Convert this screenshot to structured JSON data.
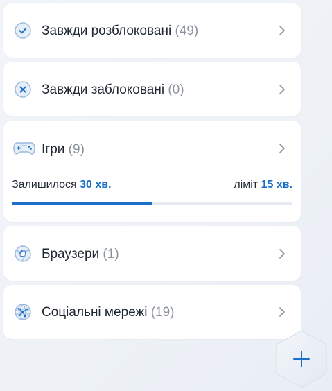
{
  "categories": [
    {
      "label": "Завжди розблоковані",
      "count": "(49)",
      "icon": "check-circle-icon"
    },
    {
      "label": "Завжди заблоковані",
      "count": "(0)",
      "icon": "x-circle-icon"
    },
    {
      "label": "Ігри",
      "count": "(9)",
      "icon": "gamepad-icon",
      "remaining_label": "Залишилося",
      "remaining_value": "30 хв.",
      "limit_label": "ліміт",
      "limit_value": "15 хв.",
      "progress_fraction": 0.5
    },
    {
      "label": "Браузери",
      "count": "(1)",
      "icon": "browser-icon"
    },
    {
      "label": "Соціальні мережі",
      "count": "(19)",
      "icon": "globe-network-icon"
    }
  ],
  "fab": {
    "icon": "plus-icon"
  },
  "colors": {
    "accent": "#1a6fc9",
    "text": "#1f2733",
    "muted": "#8a929c",
    "background": "#eef2f7"
  }
}
